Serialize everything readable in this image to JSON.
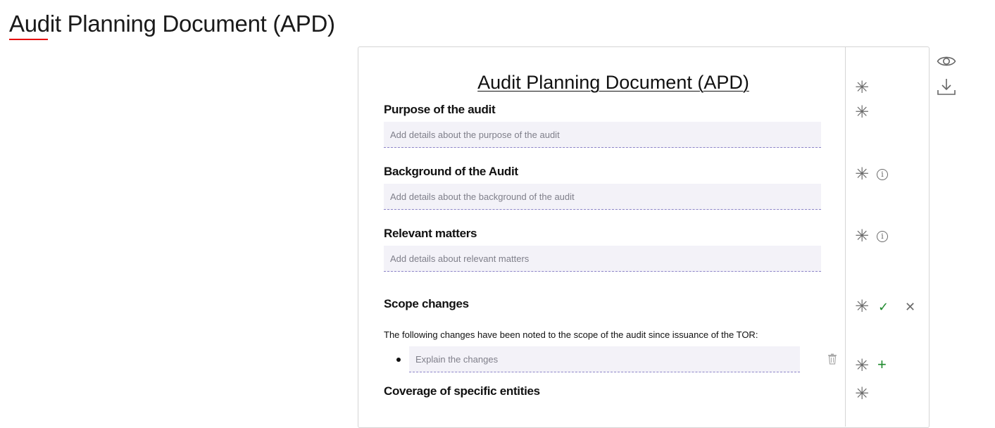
{
  "page": {
    "title": "Audit Planning Document (APD)"
  },
  "document": {
    "heading": "Audit Planning Document (APD)",
    "sections": [
      {
        "label": "Purpose of the audit",
        "placeholder": "Add details about the purpose of the audit"
      },
      {
        "label": "Background of the Audit",
        "placeholder": "Add details about the background of the audit"
      },
      {
        "label": "Relevant matters",
        "placeholder": "Add details about relevant matters"
      }
    ],
    "scope_changes": {
      "label": "Scope changes",
      "description": "The following changes have been noted to the scope of the audit since issuance of the TOR:",
      "bullet_placeholder": "Explain the changes"
    },
    "coverage": {
      "label": "Coverage of specific entities"
    }
  },
  "icons": {
    "view": "eye-icon",
    "download": "download-icon",
    "required": "asterisk-icon",
    "info": "info-icon",
    "accept": "check-icon",
    "reject": "close-icon",
    "add": "plus-icon",
    "delete": "trash-icon"
  },
  "colors": {
    "accent_red": "#e60000",
    "field_background": "#f3f2f8",
    "field_border": "#8c84c8",
    "success_green": "#1f8a2e"
  }
}
